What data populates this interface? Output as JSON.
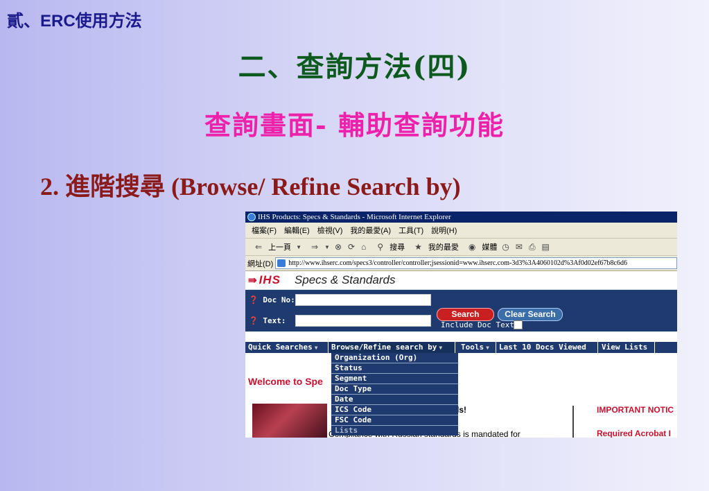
{
  "slide": {
    "top_label_prefix": "貳、",
    "top_label_en": "ERC",
    "top_label_suffix": "使用方法",
    "title": "二、查詢方法(四)",
    "subtitle": "查詢畫面- 輔助查詢功能",
    "heading": "2. 進階搜尋 (Browse/ Refine Search by)"
  },
  "browser": {
    "window_title": "IHS Products: Specs & Standards - Microsoft Internet Explorer",
    "menu": [
      "檔案(F)",
      "編輯(E)",
      "檢視(V)",
      "我的最愛(A)",
      "工具(T)",
      "說明(H)"
    ],
    "toolbar": {
      "back": "上一頁",
      "forward_icon": "⇒",
      "search": "搜尋",
      "favorites": "我的最愛",
      "media": "媒體"
    },
    "address_label": "網址(D)",
    "address_url": "http://www.ihserc.com/specs3/controller/controller;jsessionid=www.ihserc.com-3d3%3A4060102d%3Af0d02ef67b8c6d6"
  },
  "page": {
    "logo": "IHS",
    "product": "Specs & Standards",
    "doc_no_label": "Doc No:",
    "text_label": "Text:",
    "search_button": "Search",
    "clear_button": "Clear Search",
    "include_doc_text": "Include Doc Text:",
    "nav": {
      "quick_searches": "Quick Searches",
      "browse_refine": "Browse/Refine search by",
      "tools": "Tools",
      "last_10": "Last 10 Docs Viewed",
      "view_lists": "View Lists"
    },
    "dropdown_items": [
      "Organization (Org)",
      "Status",
      "Segment",
      "Doc Type",
      "Date",
      "ICS Code",
      "FSC Code",
      "Lists"
    ],
    "welcome": "Welcome to Spe",
    "news_head": "ls!",
    "news_body": "Compliance with Russian standards is mandated for",
    "important_notice": "IMPORTANT NOTIC",
    "required_acrobat": "Required Acrobat I"
  }
}
